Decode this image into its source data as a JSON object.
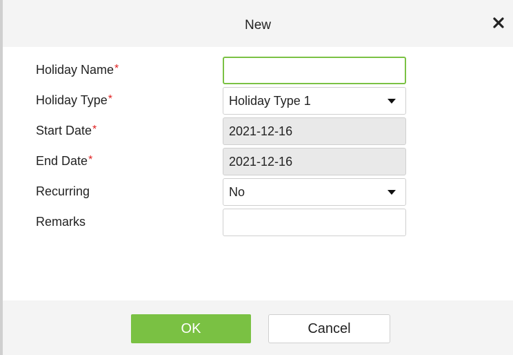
{
  "dialog": {
    "title": "New",
    "close_icon": "close-icon"
  },
  "form": {
    "holiday_name": {
      "label": "Holiday Name",
      "required": "*",
      "value": ""
    },
    "holiday_type": {
      "label": "Holiday Type",
      "required": "*",
      "value": "Holiday Type 1"
    },
    "start_date": {
      "label": "Start Date",
      "required": "*",
      "value": "2021-12-16"
    },
    "end_date": {
      "label": "End Date",
      "required": "*",
      "value": "2021-12-16"
    },
    "recurring": {
      "label": "Recurring",
      "value": "No"
    },
    "remarks": {
      "label": "Remarks",
      "value": ""
    }
  },
  "footer": {
    "ok_label": "OK",
    "cancel_label": "Cancel"
  },
  "colors": {
    "accent": "#7ac143",
    "required": "#e02020",
    "disabled_bg": "#e9e9e9"
  }
}
